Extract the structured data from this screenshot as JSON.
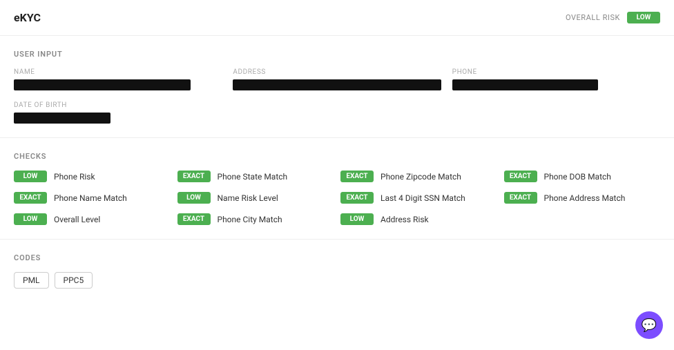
{
  "header": {
    "logo": "eKYC",
    "overall_risk_label": "OVERALL RISK",
    "overall_risk_value": "LOW"
  },
  "user_input": {
    "section_title": "USER INPUT",
    "name_label": "NAME",
    "address_label": "ADDRESS",
    "phone_label": "PHONE",
    "dob_label": "DATE OF BIRTH"
  },
  "checks": {
    "section_title": "CHECKS",
    "items": [
      {
        "badge": "LOW",
        "label": "Phone Risk",
        "type": "low"
      },
      {
        "badge": "EXACT",
        "label": "Phone State Match",
        "type": "exact"
      },
      {
        "badge": "EXACT",
        "label": "Phone Zipcode Match",
        "type": "exact"
      },
      {
        "badge": "EXACT",
        "label": "Phone DOB Match",
        "type": "exact"
      },
      {
        "badge": "EXACT",
        "label": "Phone Name Match",
        "type": "exact"
      },
      {
        "badge": "LOW",
        "label": "Name Risk Level",
        "type": "low"
      },
      {
        "badge": "EXACT",
        "label": "Last 4 Digit SSN Match",
        "type": "exact"
      },
      {
        "badge": "EXACT",
        "label": "Phone Address Match",
        "type": "exact"
      },
      {
        "badge": "LOW",
        "label": "Overall Level",
        "type": "low"
      },
      {
        "badge": "EXACT",
        "label": "Phone City Match",
        "type": "exact"
      },
      {
        "badge": "LOW",
        "label": "Address Risk",
        "type": "low"
      }
    ]
  },
  "codes": {
    "section_title": "CODES",
    "items": [
      "PML",
      "PPC5"
    ]
  }
}
